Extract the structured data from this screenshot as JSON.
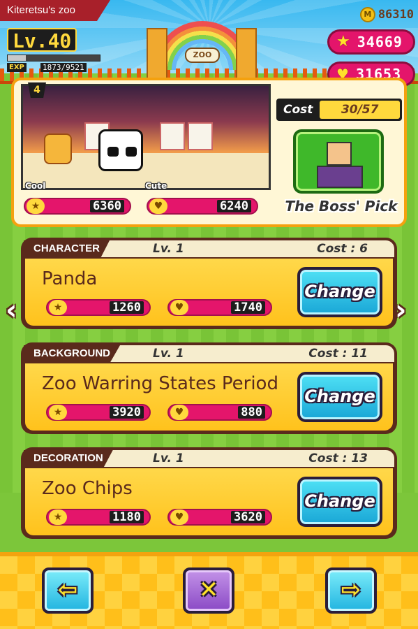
{
  "header": {
    "title": "Kiteretsu's zoo",
    "coins": "86310",
    "level_label": "Lv.40",
    "exp_label": "EXP",
    "exp_value": "1873/9521",
    "exp_fraction": 0.197,
    "stars_total": "34669",
    "hearts_total": "31653",
    "gate_sign": "ZOO"
  },
  "preview": {
    "slot_number": "4",
    "cool_label": "Cool",
    "cute_label": "Cute",
    "cool_value": "6360",
    "cute_value": "6240",
    "cost_label": "Cost",
    "cost_value": "30/57",
    "boss_pick_label": "The Boss' Pick"
  },
  "cards": [
    {
      "category": "CHARACTER",
      "level": "Lv. 1",
      "cost": "Cost : 6",
      "name": "Panda",
      "cool": "1260",
      "cute": "1740",
      "change_label": "Change"
    },
    {
      "category": "BACKGROUND",
      "level": "Lv. 1",
      "cost": "Cost : 11",
      "name": "Zoo Warring States Period",
      "cool": "3920",
      "cute": "880",
      "change_label": "Change"
    },
    {
      "category": "DECORATION",
      "level": "Lv. 1",
      "cost": "Cost : 13",
      "name": "Zoo Chips",
      "cool": "1180",
      "cute": "3620",
      "change_label": "Change"
    }
  ],
  "icons": {
    "coin": "coin-icon",
    "star": "star-icon",
    "heart": "heart-icon",
    "back": "arrow-left-icon",
    "close": "close-icon",
    "next": "arrow-right-icon"
  },
  "colors": {
    "accent_pink": "#e4156b",
    "card_brown": "#5a2a1c",
    "card_yellow": "#ffc21c",
    "button_cyan": "#19a6d6"
  }
}
